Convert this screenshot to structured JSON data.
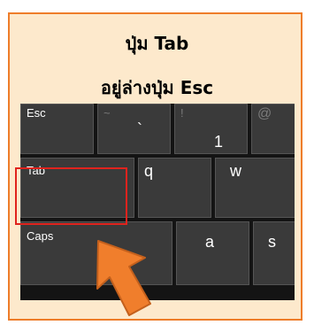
{
  "card": {
    "title_line1": "ปุ่ม Tab",
    "title_line2": "อยู่ล่างปุ่ม Esc"
  },
  "keyboard": {
    "row1": {
      "esc": "Esc",
      "tilde_shift": "~",
      "tilde_main": "`",
      "one_shift": "!",
      "one_main": "1",
      "at_shift": "@"
    },
    "row2": {
      "tab": "Tab",
      "q": "q",
      "w": "w"
    },
    "row3": {
      "caps": "Caps",
      "a": "a",
      "s": "s"
    }
  },
  "colors": {
    "card_background": "#fde9cc",
    "card_border": "#ee7d2a",
    "key_background": "#3a3a3a",
    "highlight": "#e0231d",
    "arrow": "#f07e2c"
  },
  "icons": {
    "pointer": "orange-arrow-icon"
  }
}
